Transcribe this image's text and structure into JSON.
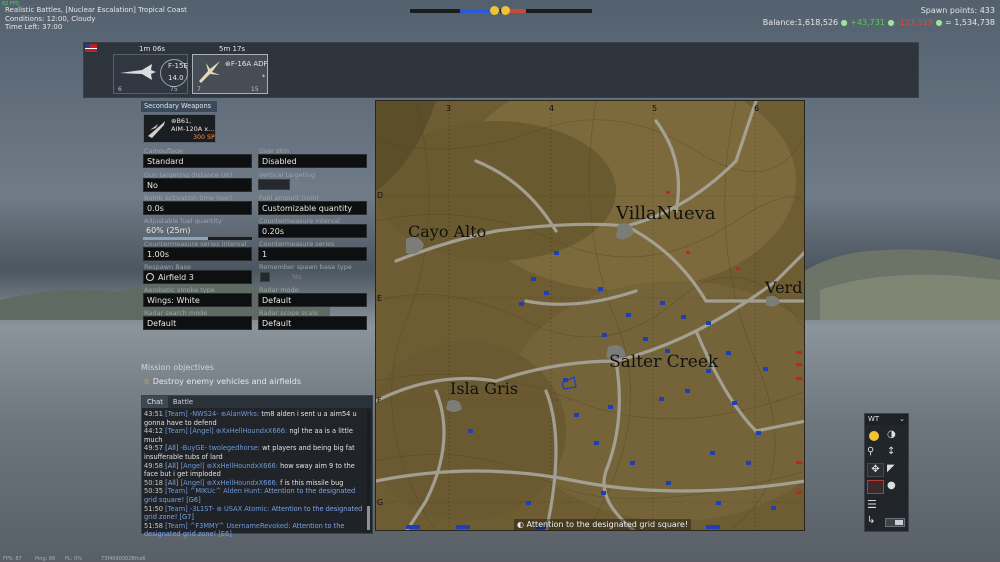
{
  "hud": {
    "fps_top": "82 FPS",
    "mission_title": "Realistic Battles, [Nuclear Escalation] Tropical Coast",
    "conditions": "Conditions: 12:00, Cloudy",
    "time_left": "Time Left: 37:00",
    "spawn_points_label": "Spawn points:",
    "spawn_points_value": "433",
    "balance_label": "Balance:",
    "balance_value": "1,618,526",
    "balance_gain": "+43,731",
    "balance_loss": "-127,519",
    "balance_total": "= 1,534,738",
    "colors": {
      "accent_green": "#4fd14f",
      "accent_red": "#e0483c",
      "sp_orange": "#ff8a3d",
      "team_blue": "#2a5ad8"
    }
  },
  "vehicles": [
    {
      "timer": "1m 06s",
      "name": "F-15E",
      "br": "14.0",
      "left_count": "6",
      "right_count": "75",
      "selected": false,
      "icon": "jet-icon"
    },
    {
      "timer": "5m 17s",
      "name": "⊛F-16A ADF",
      "br": "",
      "left_count": "7",
      "right_count": "15",
      "selected": true,
      "icon": "jet-icon"
    }
  ],
  "secondary_weapons": {
    "header": "Secondary Weapons",
    "slot_line1": "⊛B61,",
    "slot_line2": "AIM-120A x...",
    "slot_cost": "300 SP"
  },
  "settings": [
    {
      "label": "Camouflage",
      "value": "Standard"
    },
    {
      "label": "User skin",
      "value": "Disabled"
    },
    {
      "label": "Gun targeting distance (m)",
      "value": "No"
    },
    {
      "label": "Vertical targeting",
      "value": "No"
    },
    {
      "label": "Bomb activation time (sec)",
      "value": "0.0s"
    },
    {
      "label": "Fuel amount (min)",
      "value": "Customizable quantity"
    },
    {
      "label": "Adjustable fuel quantity",
      "value": "60% (25m)"
    },
    {
      "label": "Countermeasure interval",
      "value": "0.20s"
    },
    {
      "label": "Countermeasure series interval",
      "value": "1.00s"
    },
    {
      "label": "Countermeasure series",
      "value": "1"
    },
    {
      "label": "Respawn Base",
      "value": "Airfield 3"
    },
    {
      "label": "Remember spawn base type",
      "value": "No"
    },
    {
      "label": "Aerobatic smoke type",
      "value": "Wings: White"
    },
    {
      "label": "Radar mode",
      "value": "Default"
    },
    {
      "label": "Radar search mode",
      "value": "Default"
    },
    {
      "label": "Radar scope scale",
      "value": "Default"
    }
  ],
  "objectives": {
    "title": "Mission objectives",
    "item": "Destroy enemy vehicles and airfields"
  },
  "chat": {
    "tabs": [
      "Chat",
      "Battle"
    ],
    "lines": [
      {
        "time": "43:51",
        "channel": "[Team]",
        "sender": "-NWS24- ⊛AlanWrks:",
        "text": "tm8 alden i sent u a aim54 u gonna have to defend"
      },
      {
        "time": "44:12",
        "channel": "[Team]",
        "sender": "[Angel] ⊛XxHellHoundxX666:",
        "text": "ngl the aa is a little much"
      },
      {
        "time": "49:57",
        "channel": "[All]",
        "sender": "-BuyGE- twolegedhorse:",
        "text": "wt players and being big fat insufferable tubs of lard"
      },
      {
        "time": "49:58",
        "channel": "[All]",
        "sender": "[Angel] ⊛XxHellHoundxX666:",
        "text": "how sway aim 9 to the face but i get imploded"
      },
      {
        "time": "50:18",
        "channel": "[All]",
        "sender": "[Angel] ⊛XxHellHoundxX666:",
        "text": "f is this missile bug"
      },
      {
        "time": "50:35",
        "channel": "[Team]",
        "sender": "^MIKUc^ Alden Hunt:",
        "text": "Attention to the designated grid square! [G6]",
        "blue": true
      },
      {
        "time": "51:50",
        "channel": "[Team]",
        "sender": "-3L1ST- ⊛ USAX Atomic:",
        "text": "Attention to the designated grid zone! [G7]",
        "blue": true
      },
      {
        "time": "51:58",
        "channel": "[Team]",
        "sender": "^F3MMY^ UsernameRevoked:",
        "text": "Attention to the designated grid zone! [E6]",
        "blue": true
      }
    ]
  },
  "map": {
    "col_labels": [
      "3",
      "4",
      "5",
      "6"
    ],
    "row_labels": [
      "D",
      "E",
      "F",
      "G"
    ],
    "places": [
      "Cayo Alto",
      "VillaNueva",
      "Verd",
      "Salter Creek",
      "Isla Gris"
    ],
    "toast": "Attention to the designated grid square!"
  },
  "map_controls": {
    "title": "WT",
    "icons": [
      "warning-icon",
      "contrast-icon",
      "zoom-icon",
      "resize-icon",
      "move-icon",
      "cursor-icon",
      "grid-icon",
      "cursor-icon",
      "settings-icon",
      "exit-icon",
      "toggle-icon"
    ]
  },
  "footer": {
    "fps": "FPS: 87",
    "ping": "Ping: 86",
    "pl": "PL: 0%",
    "session": "73f4090002Bfce6"
  }
}
